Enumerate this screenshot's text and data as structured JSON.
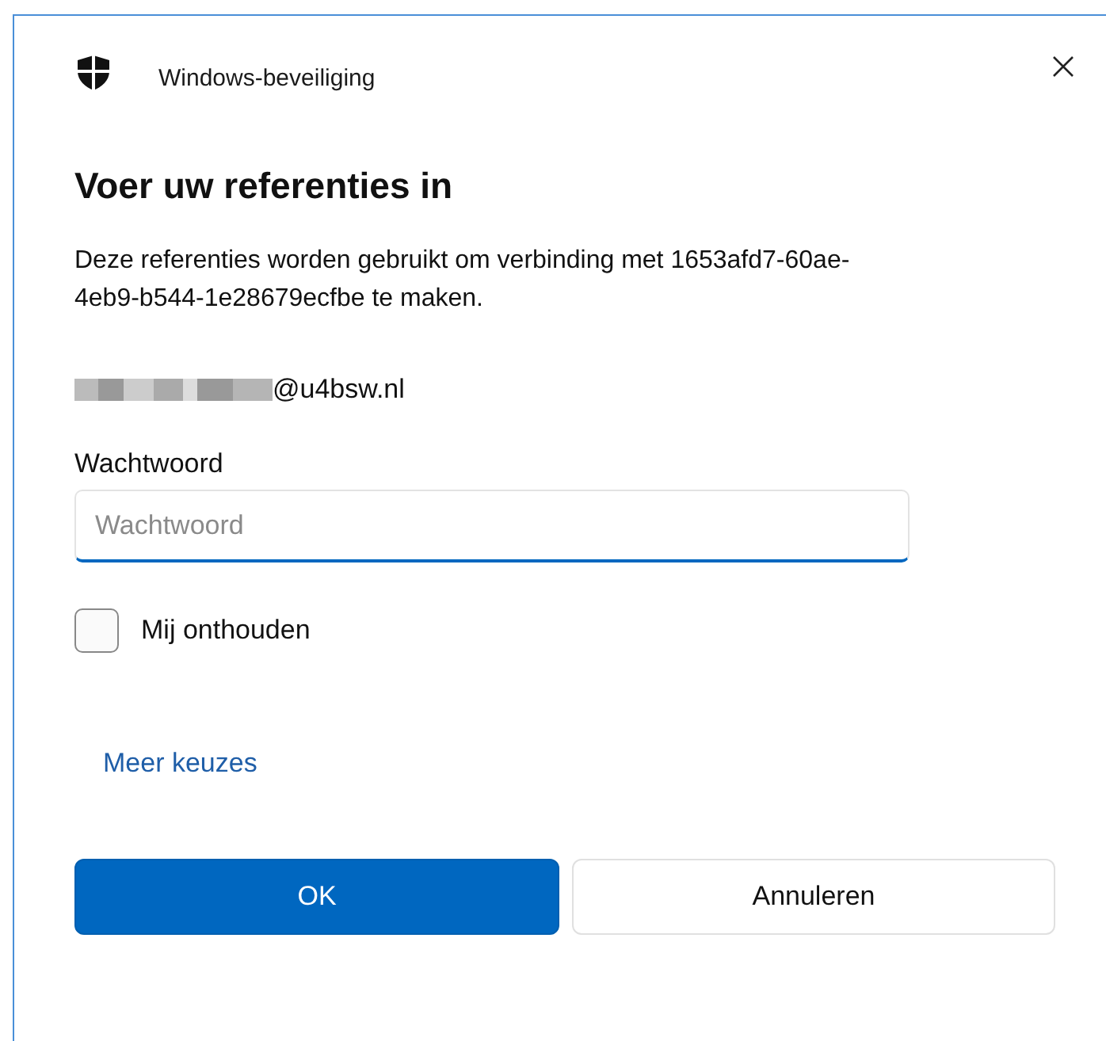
{
  "window": {
    "title": "Windows-beveiliging"
  },
  "heading": "Voer uw referenties in",
  "description": "Deze referenties worden gebruikt om verbinding met 1653afd7-60ae-4eb9-b544-1e28679ecfbe te maken.",
  "account": {
    "domain": "@u4bsw.nl"
  },
  "password": {
    "label": "Wachtwoord",
    "placeholder": "Wachtwoord",
    "focused": true
  },
  "remember": {
    "label": "Mij onthouden",
    "checked": false
  },
  "more_choices_link": "Meer keuzes",
  "buttons": [
    {
      "label": "OK",
      "kind": "primary"
    },
    {
      "label": "Annuleren",
      "kind": "secondary"
    }
  ]
}
